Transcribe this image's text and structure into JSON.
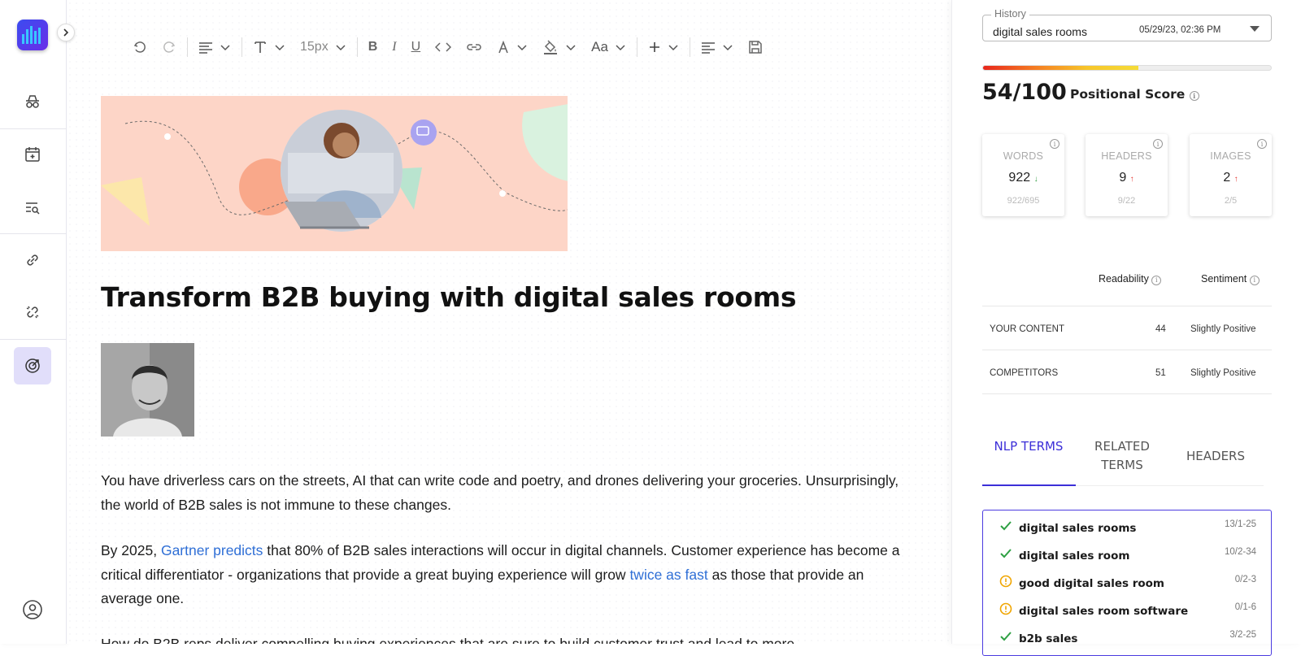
{
  "toolbar": {
    "font_size": "15px",
    "font_case": "Aa"
  },
  "article": {
    "headline": "Transform B2B buying with digital sales rooms",
    "para1": "You have driverless cars on the streets, AI that can write code and poetry, and drones delivering your groceries. Unsurprisingly, the world of B2B sales is not immune to these changes.",
    "para2_a": "By 2025, ",
    "para2_link1": "Gartner predicts",
    "para2_b": " that 80% of B2B sales interactions will occur in digital channels. Customer experience has become a critical differentiator - organizations that provide a great buying experience will grow ",
    "para2_link2": "twice as fast",
    "para2_c": " as those that provide an average one.",
    "para3": "How do B2B reps deliver compelling buying experiences that are sure to build customer trust and lead to more"
  },
  "panel": {
    "history_label": "History",
    "history_value": "digital sales rooms",
    "history_date": "05/29/23, 02:36 PM",
    "score": "54/100",
    "score_fraction": 0.54,
    "score_label": "Positional Score",
    "cards": [
      {
        "title": "WORDS",
        "value": "922",
        "arrow": "↓",
        "sub": "922/695"
      },
      {
        "title": "HEADERS",
        "value": "9",
        "arrow": "↑",
        "sub": "9/22"
      },
      {
        "title": "IMAGES",
        "value": "2",
        "arrow": "↑",
        "sub": "2/5"
      }
    ],
    "readability_label": "Readability",
    "sentiment_label": "Sentiment",
    "rows": [
      {
        "label": "YOUR CONTENT",
        "readability": "44",
        "sentiment": "Slightly Positive"
      },
      {
        "label": "COMPETITORS",
        "readability": "51",
        "sentiment": "Slightly Positive"
      }
    ],
    "tabs": [
      "NLP TERMS",
      "RELATED TERMS",
      "HEADERS"
    ],
    "terms": [
      {
        "name": "digital sales rooms",
        "value": "13/1-25",
        "status": "check"
      },
      {
        "name": "digital sales room",
        "value": "10/2-34",
        "status": "check"
      },
      {
        "name": "good digital sales room",
        "value": "0/2-3",
        "status": "warn"
      },
      {
        "name": "digital sales room software",
        "value": "0/1-6",
        "status": "warn"
      },
      {
        "name": "b2b sales",
        "value": "3/2-25",
        "status": "check"
      }
    ],
    "colors": {
      "accent": "#3c2fd8",
      "check": "#2ea043",
      "warn": "#f0a500"
    }
  }
}
